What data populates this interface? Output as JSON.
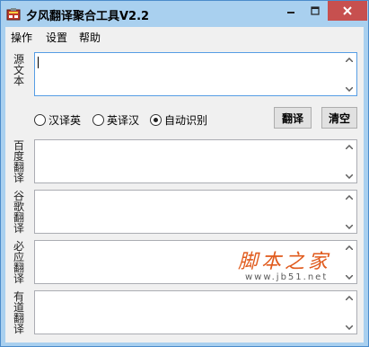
{
  "window": {
    "title": "夕风翻译聚合工具V2.2",
    "colors": {
      "title_bar": "#a9d0ef",
      "close_button": "#c7504f",
      "watermark": "#e05a1c"
    }
  },
  "menu": {
    "items": [
      {
        "label": "操作"
      },
      {
        "label": "设置"
      },
      {
        "label": "帮助"
      }
    ]
  },
  "source": {
    "label_chars": [
      "源",
      "文",
      "本"
    ],
    "value": ""
  },
  "modes": {
    "options": [
      {
        "label": "汉译英",
        "selected": false
      },
      {
        "label": "英译汉",
        "selected": false
      },
      {
        "label": "自动识别",
        "selected": true
      }
    ]
  },
  "buttons": {
    "translate": "翻译",
    "clear": "清空"
  },
  "results": [
    {
      "label_chars": [
        "百",
        "度",
        "翻",
        "译"
      ],
      "value": ""
    },
    {
      "label_chars": [
        "谷",
        "歌",
        "翻",
        "译"
      ],
      "value": ""
    },
    {
      "label_chars": [
        "必",
        "应",
        "翻",
        "译"
      ],
      "value": ""
    },
    {
      "label_chars": [
        "有",
        "道",
        "翻",
        "译"
      ],
      "value": ""
    }
  ],
  "watermark": {
    "text": "脚本之家",
    "url": "www.jb51.net"
  }
}
